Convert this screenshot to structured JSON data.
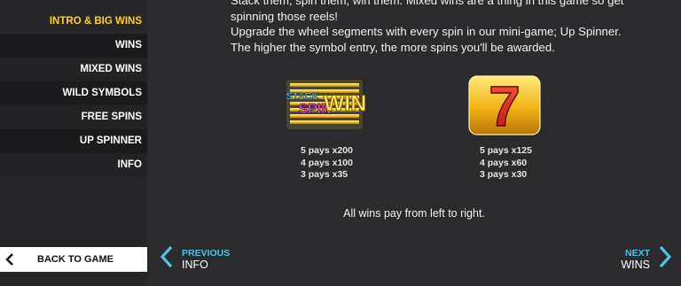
{
  "sidebar": {
    "items": [
      {
        "label": "INTRO & BIG WINS",
        "active": true
      },
      {
        "label": "WINS"
      },
      {
        "label": "MIXED WINS"
      },
      {
        "label": "WILD SYMBOLS"
      },
      {
        "label": "FREE SPINS"
      },
      {
        "label": "UP SPINNER"
      },
      {
        "label": "INFO"
      }
    ],
    "back_label": "BACK TO GAME"
  },
  "description": {
    "line1": "Stack them, spin them, win them. Mixed wins are a thing in this game so get",
    "line2": "spinning those reels!",
    "line3": "Upgrade the wheel segments with every spin in our mini-game; Up Spinner.",
    "line4": "The higher the symbol entry, the more spins you'll be awarded."
  },
  "symbols": [
    {
      "logo_top": "STACK",
      "logo_left": "SPIN",
      "logo_right": "WIN",
      "pays": [
        "5 pays x200",
        "4 pays x100",
        "3 pays x35"
      ]
    },
    {
      "glyph": "7",
      "pays": [
        "5 pays x125",
        "4 pays x60",
        "3 pays x30"
      ]
    }
  ],
  "note": "All wins pay from left to right.",
  "nav": {
    "prev_small": "PREVIOUS",
    "prev_big": "INFO",
    "next_small": "NEXT",
    "next_big": "WINS"
  },
  "colors": {
    "accent_blue": "#4ec3e8",
    "active_yellow": "#ffd21f",
    "background": "#2b2b2d"
  }
}
